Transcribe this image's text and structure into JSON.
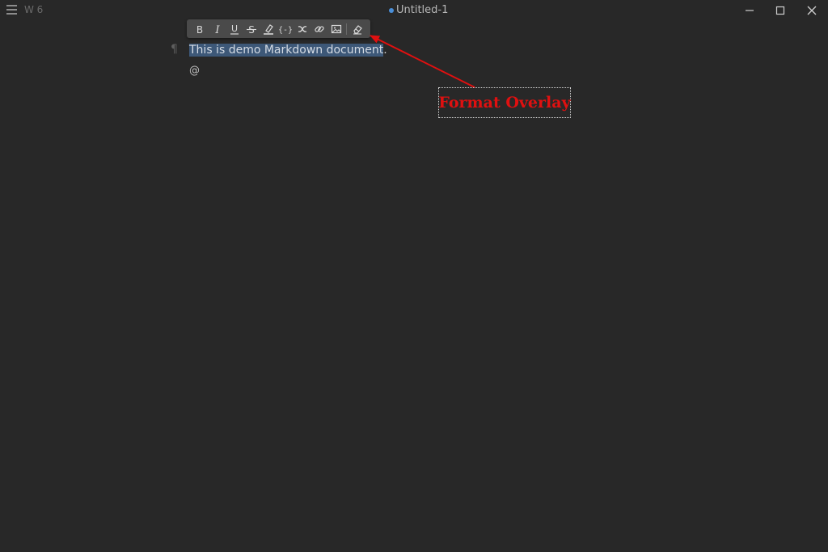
{
  "titlebar": {
    "menu_icon": "hamburger-icon",
    "word_count": "W 6",
    "title": "Untitled-1",
    "unsaved_dot_color": "#4a8fd9",
    "controls": [
      "minimize-icon",
      "maximize-icon",
      "close-icon"
    ]
  },
  "format_toolbar": {
    "buttons": [
      {
        "name": "bold",
        "glyph": "B"
      },
      {
        "name": "italic",
        "glyph": "I"
      },
      {
        "name": "underline",
        "glyph": "U"
      },
      {
        "name": "strikethrough",
        "glyph": "S"
      },
      {
        "name": "highlight",
        "icon": "highlighter-icon"
      },
      {
        "name": "inline-code",
        "glyph": "{-}"
      },
      {
        "name": "inline-math",
        "icon": "math-icon"
      },
      {
        "name": "link",
        "icon": "link-icon"
      },
      {
        "name": "image",
        "icon": "image-icon"
      },
      {
        "name": "clear-format",
        "icon": "eraser-icon"
      }
    ]
  },
  "document": {
    "paragraph_mark": "¶",
    "selected_text": "This is demo Markdown document",
    "trailing_text": ".",
    "second_line": "@"
  },
  "annotation": {
    "label": "Format Overlay",
    "color": "#e01010"
  },
  "colors": {
    "background": "#282828",
    "selection": "#3d5878",
    "toolbar": "#4a4a4a"
  }
}
